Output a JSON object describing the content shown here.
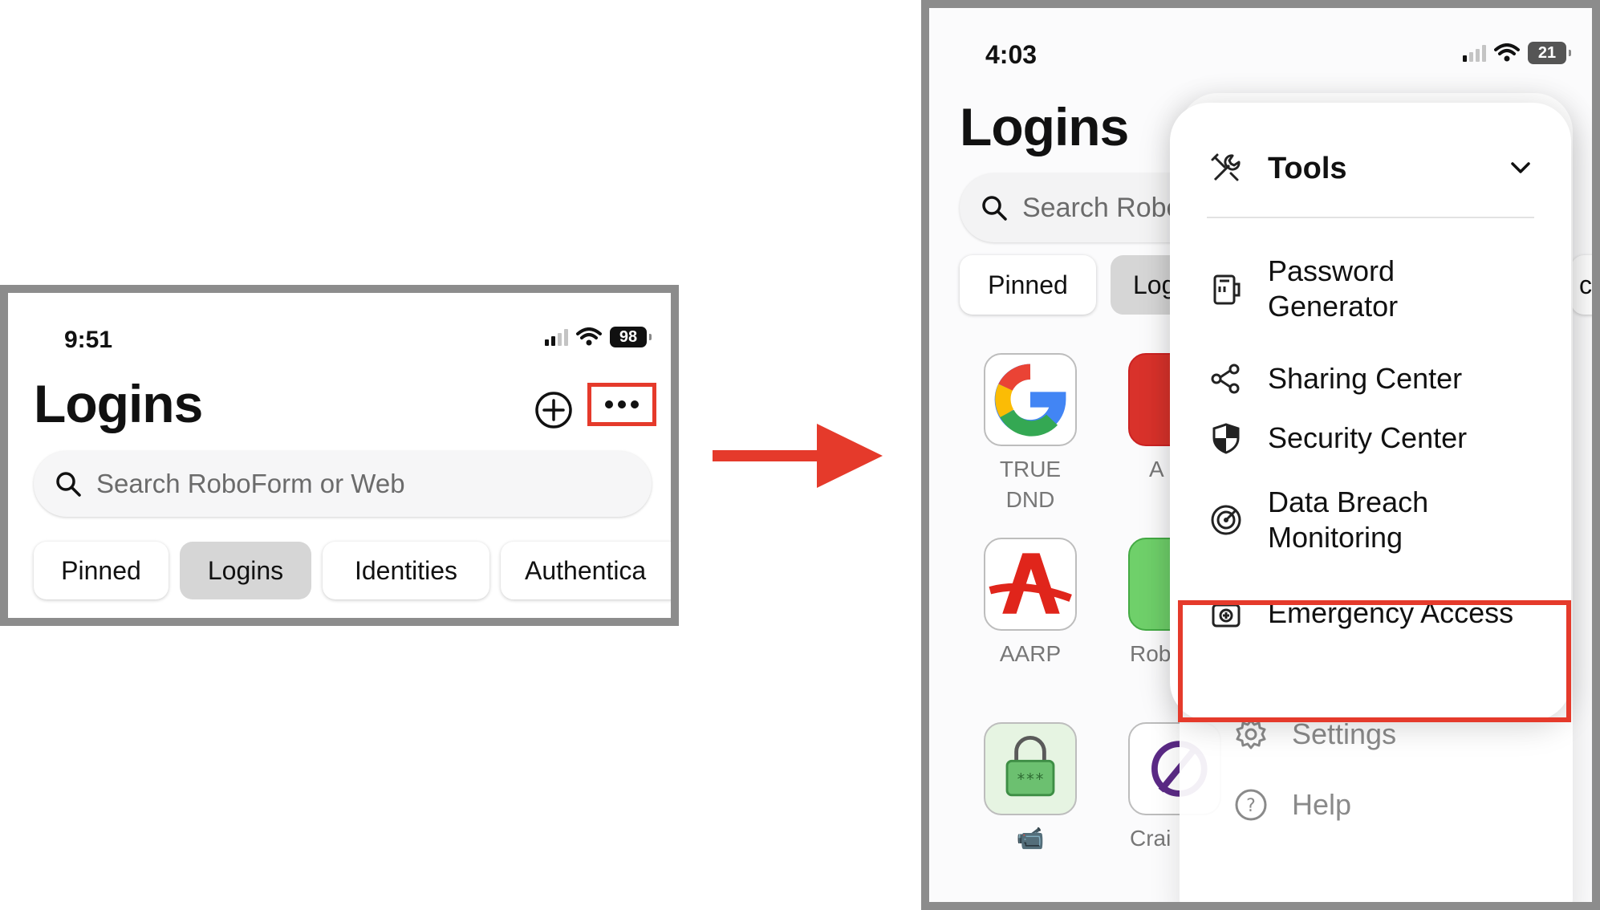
{
  "left_screen": {
    "status_time": "9:51",
    "battery": "98",
    "title": "Logins",
    "search_placeholder": "Search RoboForm or Web",
    "tabs": [
      "Pinned",
      "Logins",
      "Identities",
      "Authentica"
    ],
    "active_tab": "Logins"
  },
  "right_screen": {
    "status_time": "4:03",
    "battery": "21",
    "title": "Logins",
    "search_placeholder": "Search Robo",
    "tabs": [
      "Pinned",
      "Log",
      "ca"
    ],
    "apps": [
      {
        "label": "TRUE DND",
        "icon": "google-icon"
      },
      {
        "label": "A",
        "icon": "red-app-icon"
      },
      {
        "label": "AARP",
        "icon": "aarp-icon"
      },
      {
        "label": "Rob",
        "icon": "green-app-icon"
      },
      {
        "label": "📹",
        "icon": "password-lock-icon"
      },
      {
        "label": "Crai",
        "icon": "purple-app-icon"
      }
    ],
    "menu": {
      "header": "Tools",
      "items": [
        {
          "label": "Password Generator",
          "icon": "password-generator-icon"
        },
        {
          "label": "Sharing Center",
          "icon": "share-icon"
        },
        {
          "label": "Security Center",
          "icon": "shield-icon"
        },
        {
          "label": "Data Breach Monitoring",
          "icon": "radar-icon"
        },
        {
          "label": "Emergency Access",
          "icon": "medical-kit-icon"
        }
      ],
      "below_items": [
        {
          "label": "Settings",
          "icon": "gear-icon"
        },
        {
          "label": "Help",
          "icon": "help-icon"
        }
      ]
    }
  },
  "colors": {
    "highlight": "#e53a2b",
    "active_tab": "#d6d6d6"
  }
}
